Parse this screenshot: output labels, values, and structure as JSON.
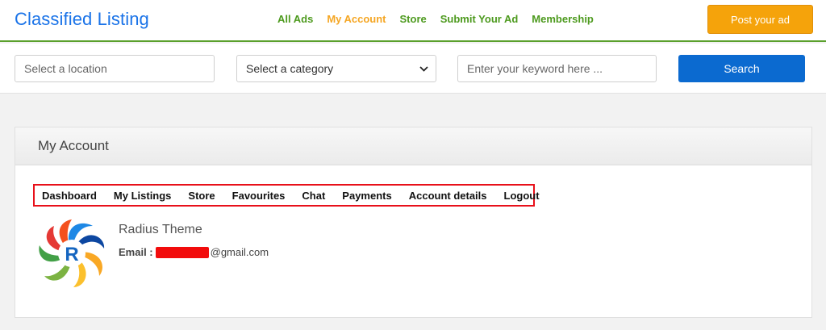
{
  "header": {
    "brand": "Classified Listing",
    "nav": [
      {
        "label": "All Ads"
      },
      {
        "label": "My Account"
      },
      {
        "label": "Store"
      },
      {
        "label": "Submit Your Ad"
      },
      {
        "label": "Membership"
      }
    ],
    "active_nav": "My Account",
    "post_button": "Post your ad"
  },
  "search": {
    "location_placeholder": "Select a location",
    "category_value": "Select a category",
    "keyword_placeholder": "Enter your keyword here ...",
    "button": "Search"
  },
  "account": {
    "title": "My Account",
    "tabs": [
      "Dashboard",
      "My Listings",
      "Store",
      "Favourites",
      "Chat",
      "Payments",
      "Account details",
      "Logout"
    ],
    "user_name": "Radius Theme",
    "email_label": "Email :",
    "email_domain": "@gmail.com",
    "avatar_letter": "R"
  },
  "colors": {
    "brand_blue": "#1a73e8",
    "nav_green": "#4d9a1e",
    "active_orange": "#f5a623",
    "post_button": "#f5a30b",
    "search_button": "#0b6ad0",
    "highlight_red": "#e8101a"
  }
}
